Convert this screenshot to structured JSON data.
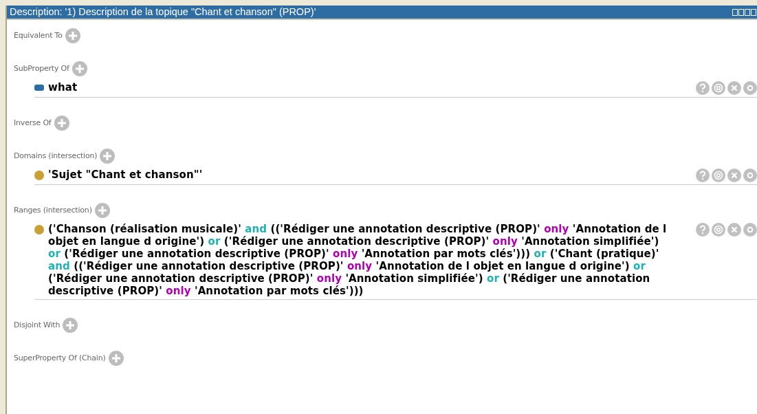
{
  "window": {
    "title": "Description: '1) Description de la topique \"Chant et chanson\" (PROP)'"
  },
  "sections": [
    {
      "label": "Equivalent To"
    },
    {
      "label": "SubProperty Of",
      "items": [
        {
          "kind": "property",
          "segments": [
            {
              "kind": "plain",
              "text": "what"
            }
          ]
        }
      ]
    },
    {
      "label": "Inverse Of"
    },
    {
      "label": "Domains (intersection)",
      "items": [
        {
          "kind": "class",
          "segments": [
            {
              "kind": "plain",
              "text": "'Sujet \"Chant et chanson\"'"
            }
          ]
        }
      ]
    },
    {
      "label": "Ranges (intersection)",
      "items": [
        {
          "kind": "class",
          "segments": [
            {
              "kind": "plain",
              "text": "('Chanson (réalisation musicale)'"
            },
            {
              "kind": "keyword",
              "color": "#20b2b2",
              "text": "and"
            },
            {
              "kind": "plain",
              "text": "(('Rédiger une annotation descriptive (PROP)'"
            },
            {
              "kind": "keyword",
              "color": "#b000b0",
              "text": "only"
            },
            {
              "kind": "plain",
              "text": "'Annotation de l objet en langue d origine')"
            },
            {
              "kind": "keyword",
              "color": "#20b2b2",
              "text": "or"
            },
            {
              "kind": "plain",
              "text": "('Rédiger une annotation descriptive (PROP)'"
            },
            {
              "kind": "keyword",
              "color": "#b000b0",
              "text": "only"
            },
            {
              "kind": "plain",
              "text": "'Annotation simplifiée')"
            },
            {
              "kind": "keyword",
              "color": "#20b2b2",
              "text": "or"
            },
            {
              "kind": "plain",
              "text": "('Rédiger une annotation descriptive (PROP)'"
            },
            {
              "kind": "keyword",
              "color": "#b000b0",
              "text": "only"
            },
            {
              "kind": "plain",
              "text": "'Annotation par mots clés')))"
            },
            {
              "kind": "keyword",
              "color": "#20b2b2",
              "text": "or"
            },
            {
              "kind": "plain",
              "text": "('Chant (pratique)'"
            },
            {
              "kind": "keyword",
              "color": "#20b2b2",
              "text": "and"
            },
            {
              "kind": "plain",
              "text": "(('Rédiger une annotation descriptive (PROP)'"
            },
            {
              "kind": "keyword",
              "color": "#b000b0",
              "text": "only"
            },
            {
              "kind": "plain",
              "text": "'Annotation de l objet en langue d origine')"
            },
            {
              "kind": "keyword",
              "color": "#20b2b2",
              "text": "or"
            },
            {
              "kind": "plain",
              "text": "('Rédiger une annotation descriptive (PROP)'"
            },
            {
              "kind": "keyword",
              "color": "#b000b0",
              "text": "only"
            },
            {
              "kind": "plain",
              "text": "'Annotation simplifiée')"
            },
            {
              "kind": "keyword",
              "color": "#20b2b2",
              "text": "or"
            },
            {
              "kind": "plain",
              "text": "('Rédiger une annotation descriptive (PROP)'"
            },
            {
              "kind": "keyword",
              "color": "#b000b0",
              "text": "only"
            },
            {
              "kind": "plain",
              "text": "'Annotation par mots clés')))"
            }
          ]
        }
      ]
    },
    {
      "label": "Disjoint With"
    },
    {
      "label": "SuperProperty Of (Chain)"
    }
  ]
}
